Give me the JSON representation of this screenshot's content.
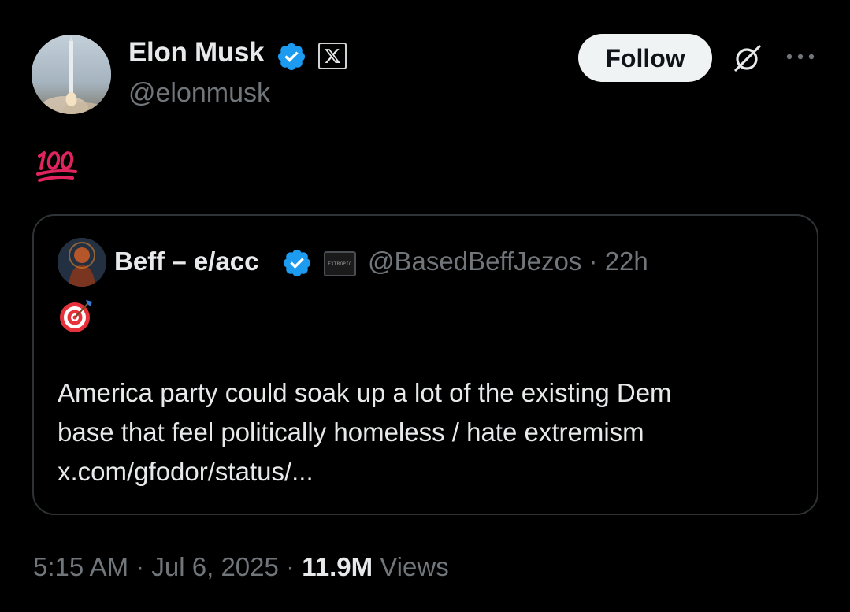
{
  "author": {
    "name": "Elon Musk",
    "handle": "@elonmusk",
    "verified": true,
    "affiliation_icon": "x-logo-icon",
    "avatar_icon": "rocket-launch-avatar"
  },
  "actions": {
    "follow_label": "Follow",
    "grok_icon": "grok-icon",
    "more_icon": "more-dots-icon"
  },
  "tweet": {
    "emoji": "hundred-points-emoji"
  },
  "quote": {
    "name": "Beff – e/acc",
    "handle_time": "@BasedBeffJezos · 22h",
    "verified": true,
    "affiliation_icon": "extropic-logo-icon",
    "affiliation_text": "EXTROPIC",
    "emoji": "direct-hit-target-emoji",
    "text_lines": [
      "America party could soak up a lot of the existing Dem",
      "base that feel politically homeless / hate extremism",
      "x.com/gfodor/status/..."
    ]
  },
  "meta": {
    "time_date": "5:15 AM · Jul 6, 2025 · ",
    "views_count": "11.9M",
    "views_label": " Views"
  },
  "colors": {
    "background": "#000000",
    "primary_text": "#e7e9ea",
    "secondary_text": "#71767b",
    "verified_blue": "#1d9bf0",
    "border": "#2f3336",
    "follow_bg": "#eff3f4"
  }
}
